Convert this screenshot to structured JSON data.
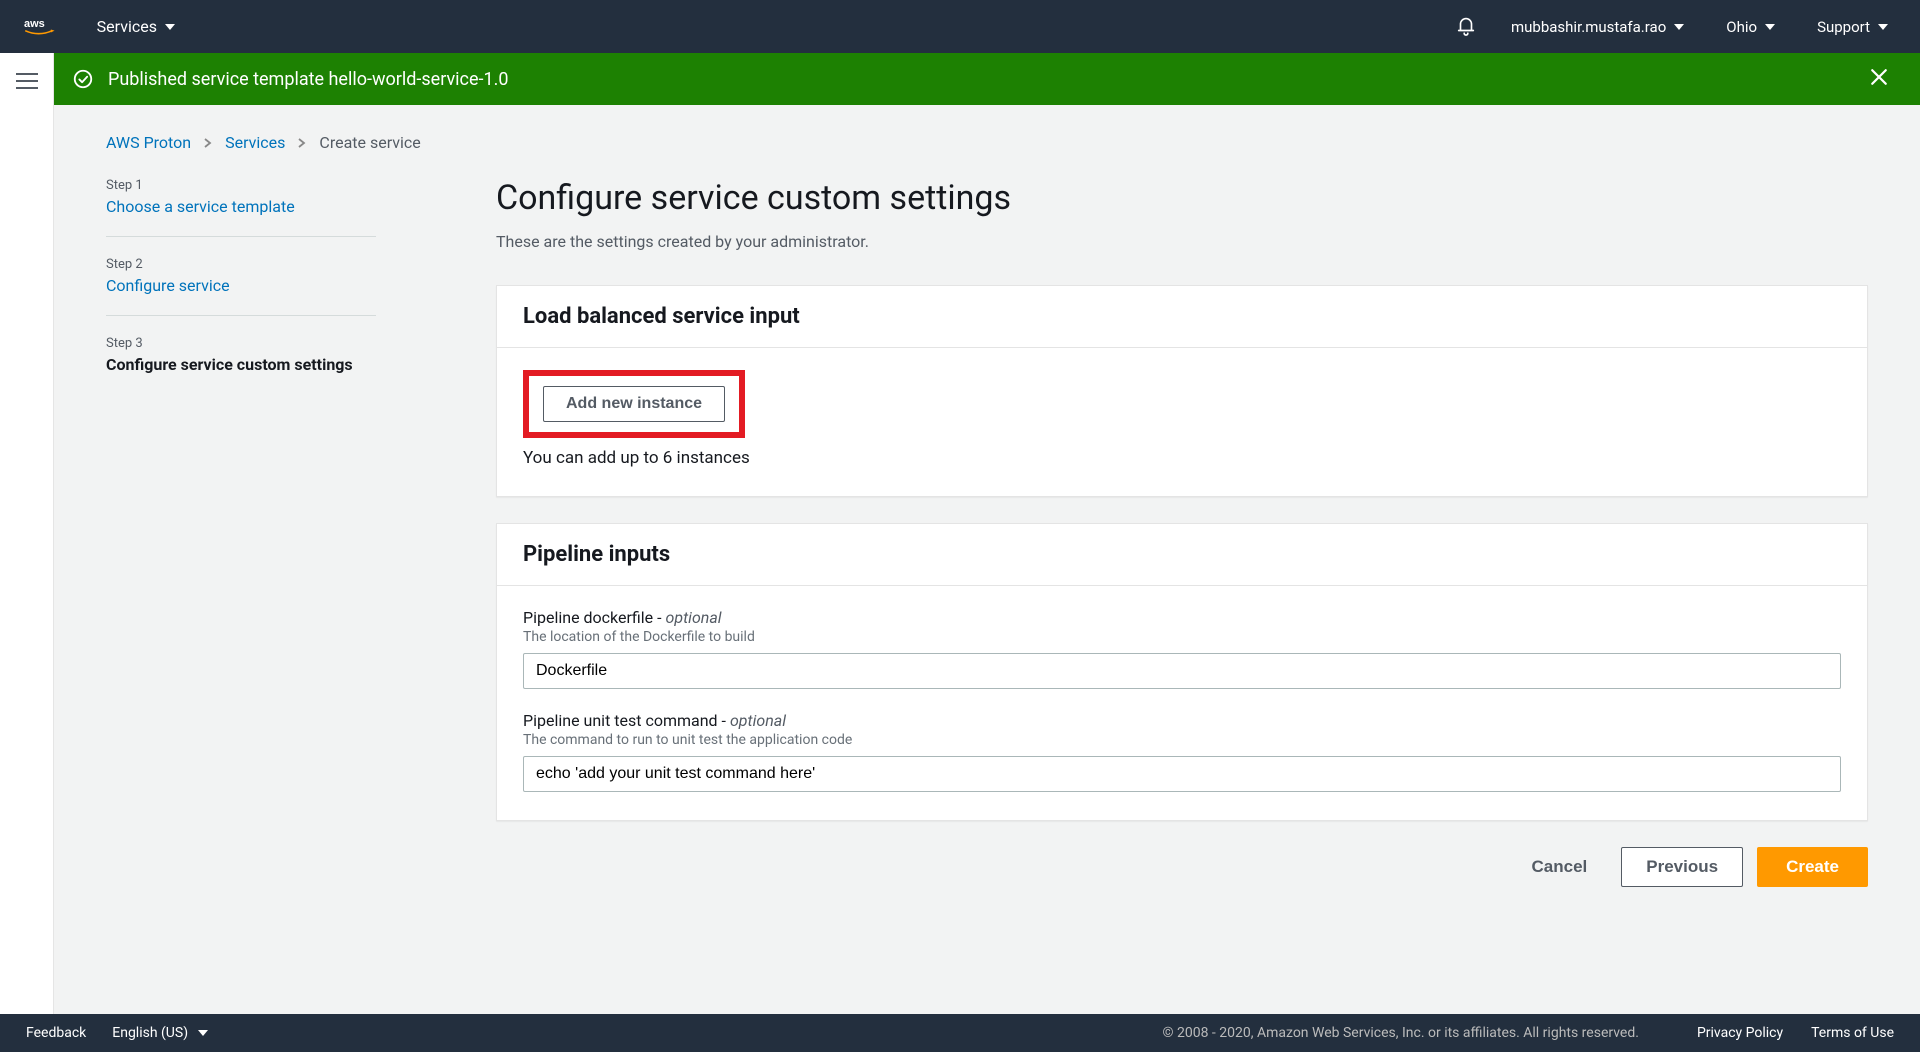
{
  "nav": {
    "services": "Services",
    "user": "mubbashir.mustafa.rao",
    "region": "Ohio",
    "support": "Support"
  },
  "alert": {
    "text": "Published service template hello-world-service-1.0"
  },
  "breadcrumbs": {
    "root": "AWS Proton",
    "services": "Services",
    "current": "Create service"
  },
  "steps": [
    {
      "num": "Step 1",
      "title": "Choose a service template"
    },
    {
      "num": "Step 2",
      "title": "Configure service"
    },
    {
      "num": "Step 3",
      "title": "Configure service custom settings"
    }
  ],
  "page": {
    "title": "Configure service custom settings",
    "subtitle": "These are the settings created by your administrator."
  },
  "panel_instances": {
    "header": "Load balanced service input",
    "add_btn": "Add new instance",
    "hint": "You can add up to 6 instances"
  },
  "panel_pipeline": {
    "header": "Pipeline inputs",
    "dockerfile": {
      "label": "Pipeline dockerfile - ",
      "opt": "optional",
      "desc": "The location of the Dockerfile to build",
      "value": "Dockerfile"
    },
    "unit_test": {
      "label": "Pipeline unit test command - ",
      "opt": "optional",
      "desc": "The command to run to unit test the application code",
      "value": "echo 'add your unit test command here'"
    }
  },
  "actions": {
    "cancel": "Cancel",
    "previous": "Previous",
    "create": "Create"
  },
  "footer": {
    "feedback": "Feedback",
    "lang": "English (US)",
    "copy": "© 2008 - 2020, Amazon Web Services, Inc. or its affiliates. All rights reserved.",
    "privacy": "Privacy Policy",
    "terms": "Terms of Use"
  }
}
